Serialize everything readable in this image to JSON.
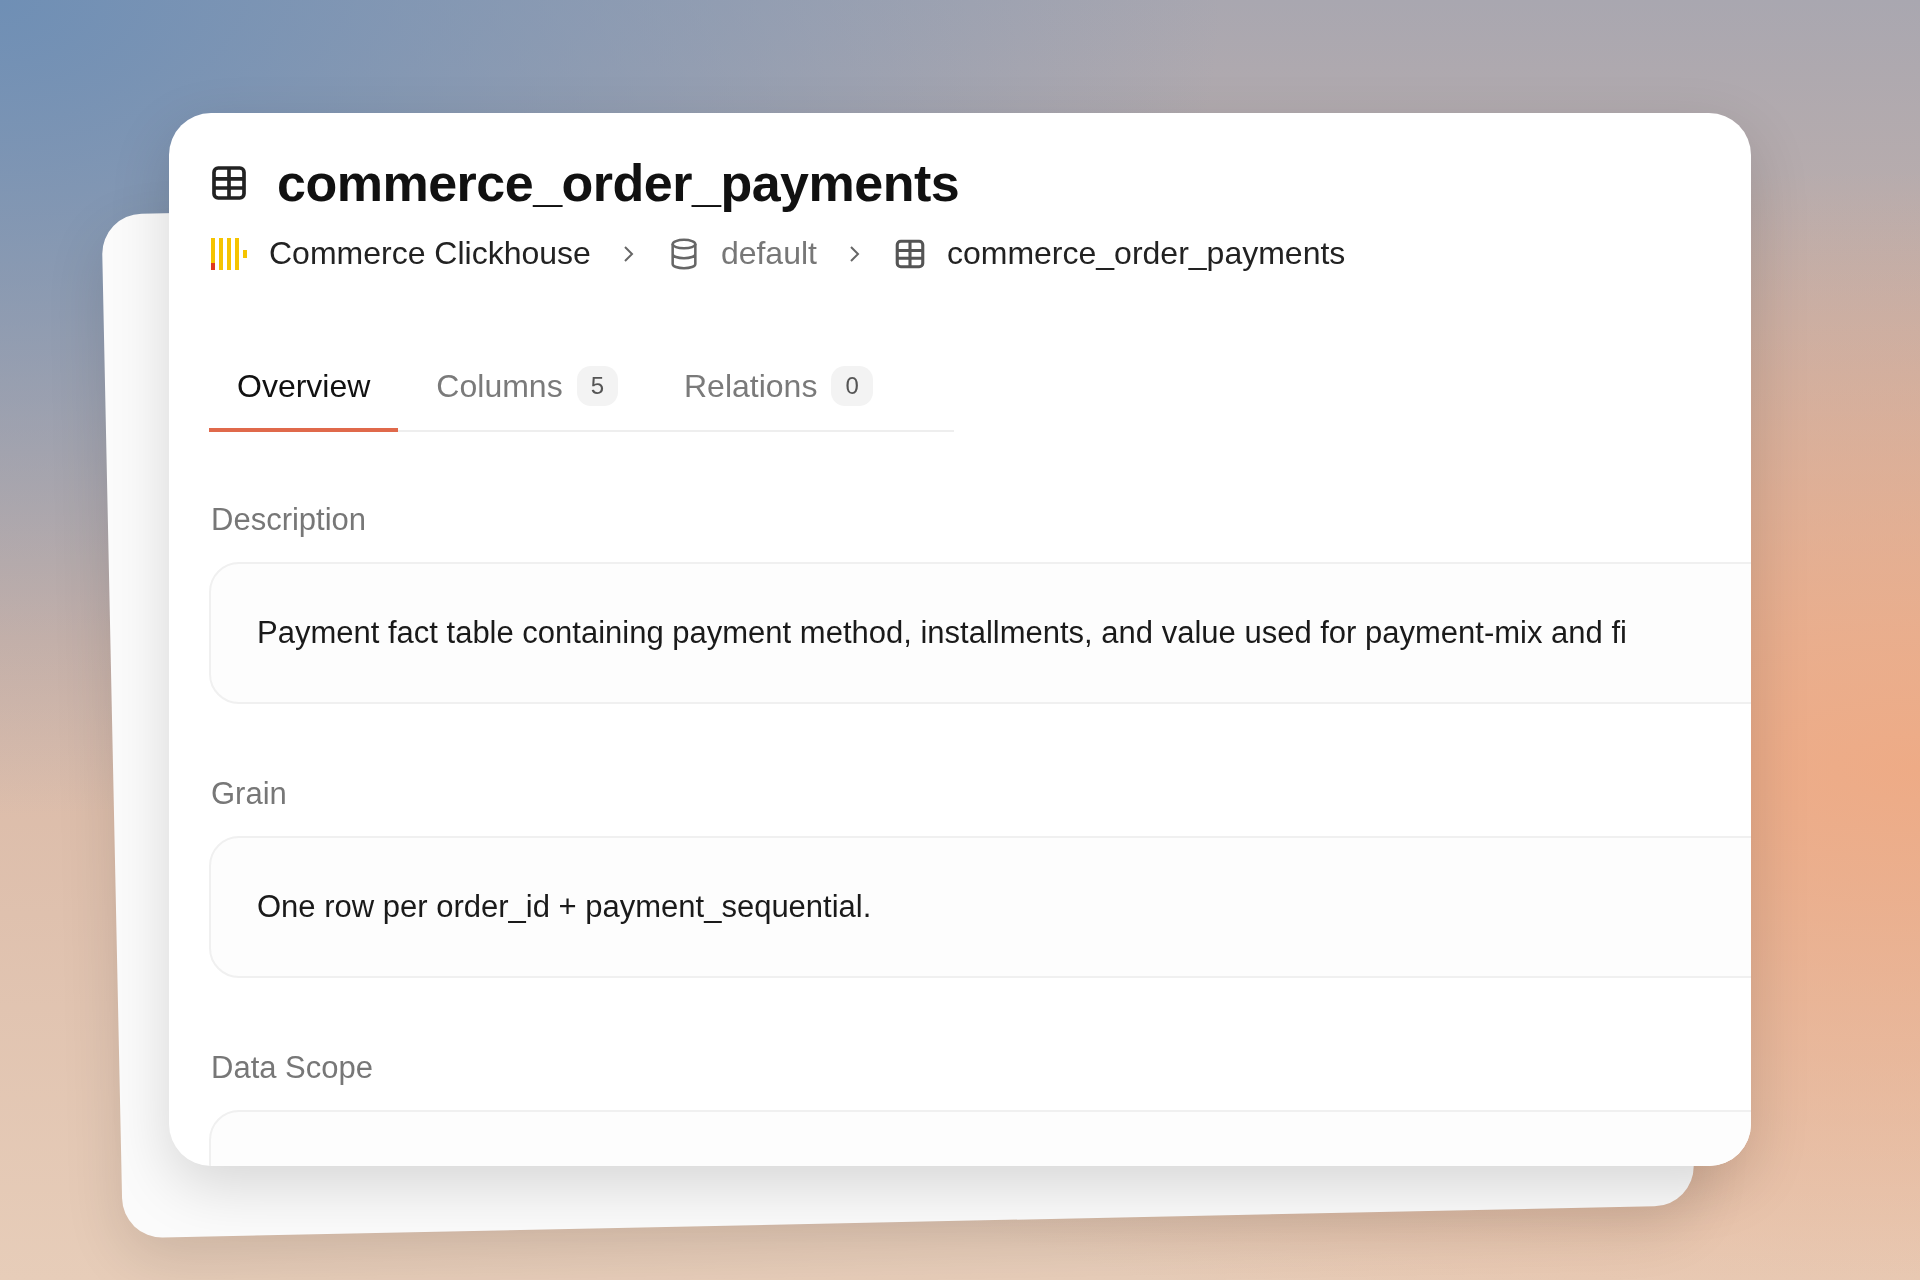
{
  "title": "commerce_order_payments",
  "breadcrumb": [
    {
      "kind": "source",
      "label": "Commerce Clickhouse"
    },
    {
      "kind": "database",
      "label": "default"
    },
    {
      "kind": "table",
      "label": "commerce_order_payments"
    }
  ],
  "tabs": [
    {
      "label": "Overview",
      "selected": true
    },
    {
      "label": "Columns",
      "count": "5",
      "selected": false
    },
    {
      "label": "Relations",
      "count": "0",
      "selected": false
    }
  ],
  "sections": [
    {
      "label": "Description",
      "text": "Payment fact table containing payment method, installments, and value used for payment-mix and fi"
    },
    {
      "label": "Grain",
      "text": "One row per order_id + payment_sequential."
    },
    {
      "label": "Data Scope"
    }
  ]
}
